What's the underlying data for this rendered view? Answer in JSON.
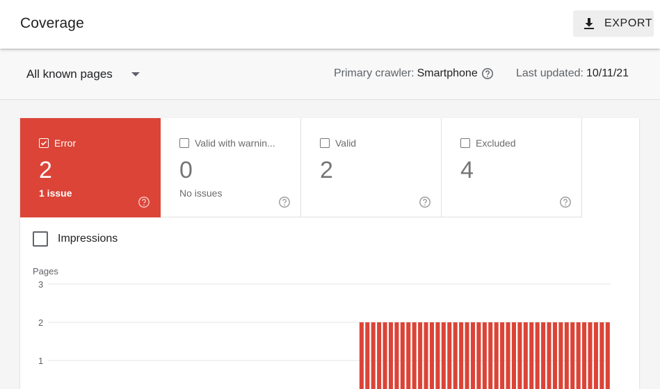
{
  "header": {
    "title": "Coverage",
    "export_label": "EXPORT"
  },
  "filter": {
    "page_select": "All known pages",
    "crawler_label": "Primary crawler:",
    "crawler_value": "Smartphone",
    "updated_label": "Last updated:",
    "updated_value": "10/11/21"
  },
  "tiles": [
    {
      "label": "Error",
      "count": "2",
      "sub": "1 issue",
      "active": true
    },
    {
      "label": "Valid with warnin...",
      "count": "0",
      "sub": "No issues",
      "active": false
    },
    {
      "label": "Valid",
      "count": "2",
      "sub": "",
      "active": false
    },
    {
      "label": "Excluded",
      "count": "4",
      "sub": "",
      "active": false
    }
  ],
  "impressions_label": "Impressions",
  "colors": {
    "error": "#db4437",
    "text": "#202124",
    "muted": "#5f6368"
  },
  "chart_data": {
    "type": "bar",
    "ylabel": "Pages",
    "yticks": [
      3,
      2,
      1
    ],
    "ylim": [
      0,
      3
    ],
    "bar_color": "#db4437",
    "values": [
      2,
      2,
      2,
      2,
      2,
      2,
      2,
      2,
      2,
      2,
      2,
      2,
      2,
      2,
      2,
      2,
      2,
      2,
      2,
      2,
      2,
      2,
      2,
      2,
      2,
      2,
      2,
      2,
      2,
      2,
      2,
      2,
      2,
      2,
      2,
      2,
      2,
      2,
      2,
      2,
      2,
      2,
      2
    ],
    "empty_slots_before": 53
  }
}
